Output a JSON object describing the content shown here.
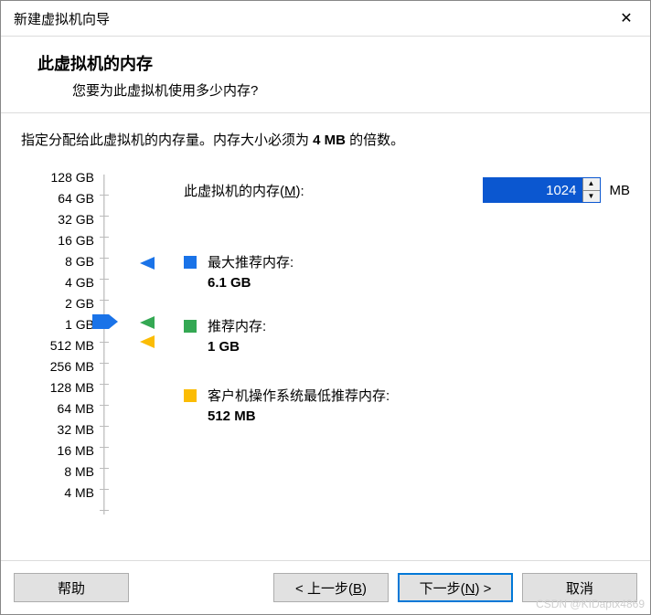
{
  "window": {
    "title": "新建虚拟机向导"
  },
  "header": {
    "title": "此虚拟机的内存",
    "subtitle": "您要为此虚拟机使用多少内存?"
  },
  "instruction": {
    "prefix": "指定分配给此虚拟机的内存量。内存大小必须为 ",
    "bold": "4 MB",
    "suffix": " 的倍数。"
  },
  "memory": {
    "label_prefix": "此虚拟机的内存(",
    "label_mnemonic": "M",
    "label_suffix": "):",
    "value": "1024",
    "unit": "MB"
  },
  "scale": {
    "ticks": [
      "128 GB",
      "64 GB",
      "32 GB",
      "16 GB",
      "8 GB",
      "4 GB",
      "2 GB",
      "1 GB",
      "512 MB",
      "256 MB",
      "128 MB",
      "64 MB",
      "32 MB",
      "16 MB",
      "8 MB",
      "4 MB"
    ]
  },
  "markers": {
    "max": {
      "color": "#1a73e8",
      "label": "最大推荐内存:",
      "value": "6.1 GB"
    },
    "rec": {
      "color": "#34a853",
      "label": "推荐内存:",
      "value": "1 GB"
    },
    "min": {
      "color": "#fbbc04",
      "label": "客户机操作系统最低推荐内存:",
      "value": "512 MB"
    }
  },
  "buttons": {
    "help": "帮助",
    "back_prefix": "< 上一步(",
    "back_m": "B",
    "back_suffix": ")",
    "next_prefix": "下一步(",
    "next_m": "N",
    "next_suffix": ") >",
    "cancel": "取消"
  },
  "watermark": "CSDN @KIDaptx4869"
}
